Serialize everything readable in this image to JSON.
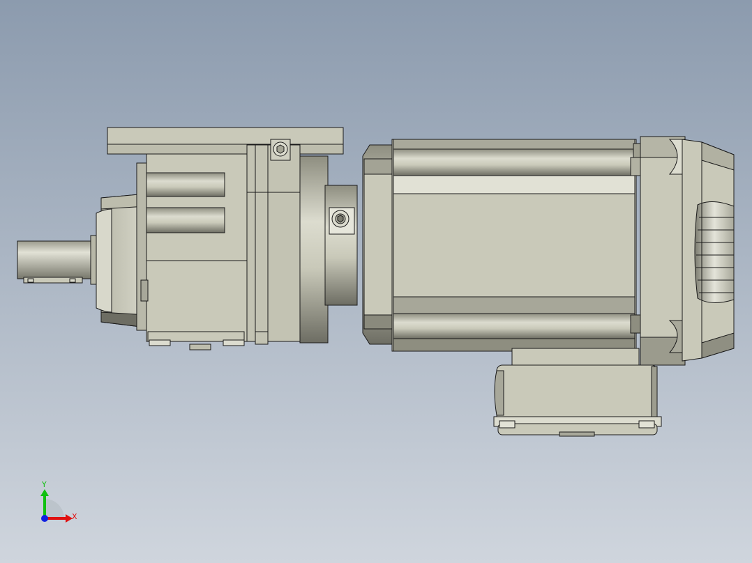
{
  "viewport": {
    "background_top": "#8c9bae",
    "background_bottom": "#cfd5dd"
  },
  "model": {
    "body_color": "#c9c9b9",
    "light_color": "#dcdccf",
    "shade_color": "#9f9f90",
    "dark_color": "#6d6d63",
    "edge_color": "#1a1a1a"
  },
  "triad": {
    "x_label": "X",
    "y_label": "Y",
    "x_color": "#e01010",
    "y_color": "#10c010",
    "z_color": "#1020e0",
    "icon": "coordinate-triad-icon"
  }
}
